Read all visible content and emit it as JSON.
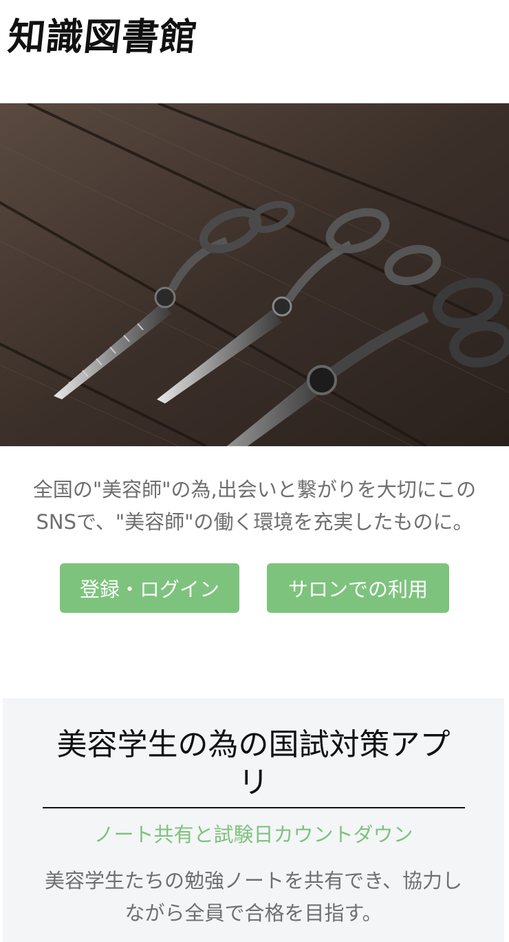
{
  "header": {
    "logo_text": "知識図書館"
  },
  "hero": {
    "image_name": "scissors-on-wood-photo"
  },
  "intro": {
    "text": "全国の\"美容師\"の為,出会いと繋がりを大切にこのSNSで、\"美容師\"の働く環境を充実したものに。"
  },
  "actions": {
    "login_label": "登録・ログイン",
    "salon_label": "サロンでの利用"
  },
  "feature": {
    "title": "美容学生の為の国試対策アプリ",
    "subtitle": "ノート共有と試験日カウントダウン",
    "description": "美容学生たちの勉強ノートを共有でき、協力しながら全員で合格を目指す。"
  },
  "colors": {
    "accent": "#7dc37d",
    "text_gray": "#6f6f6f",
    "section_bg": "#f4f5f7"
  }
}
